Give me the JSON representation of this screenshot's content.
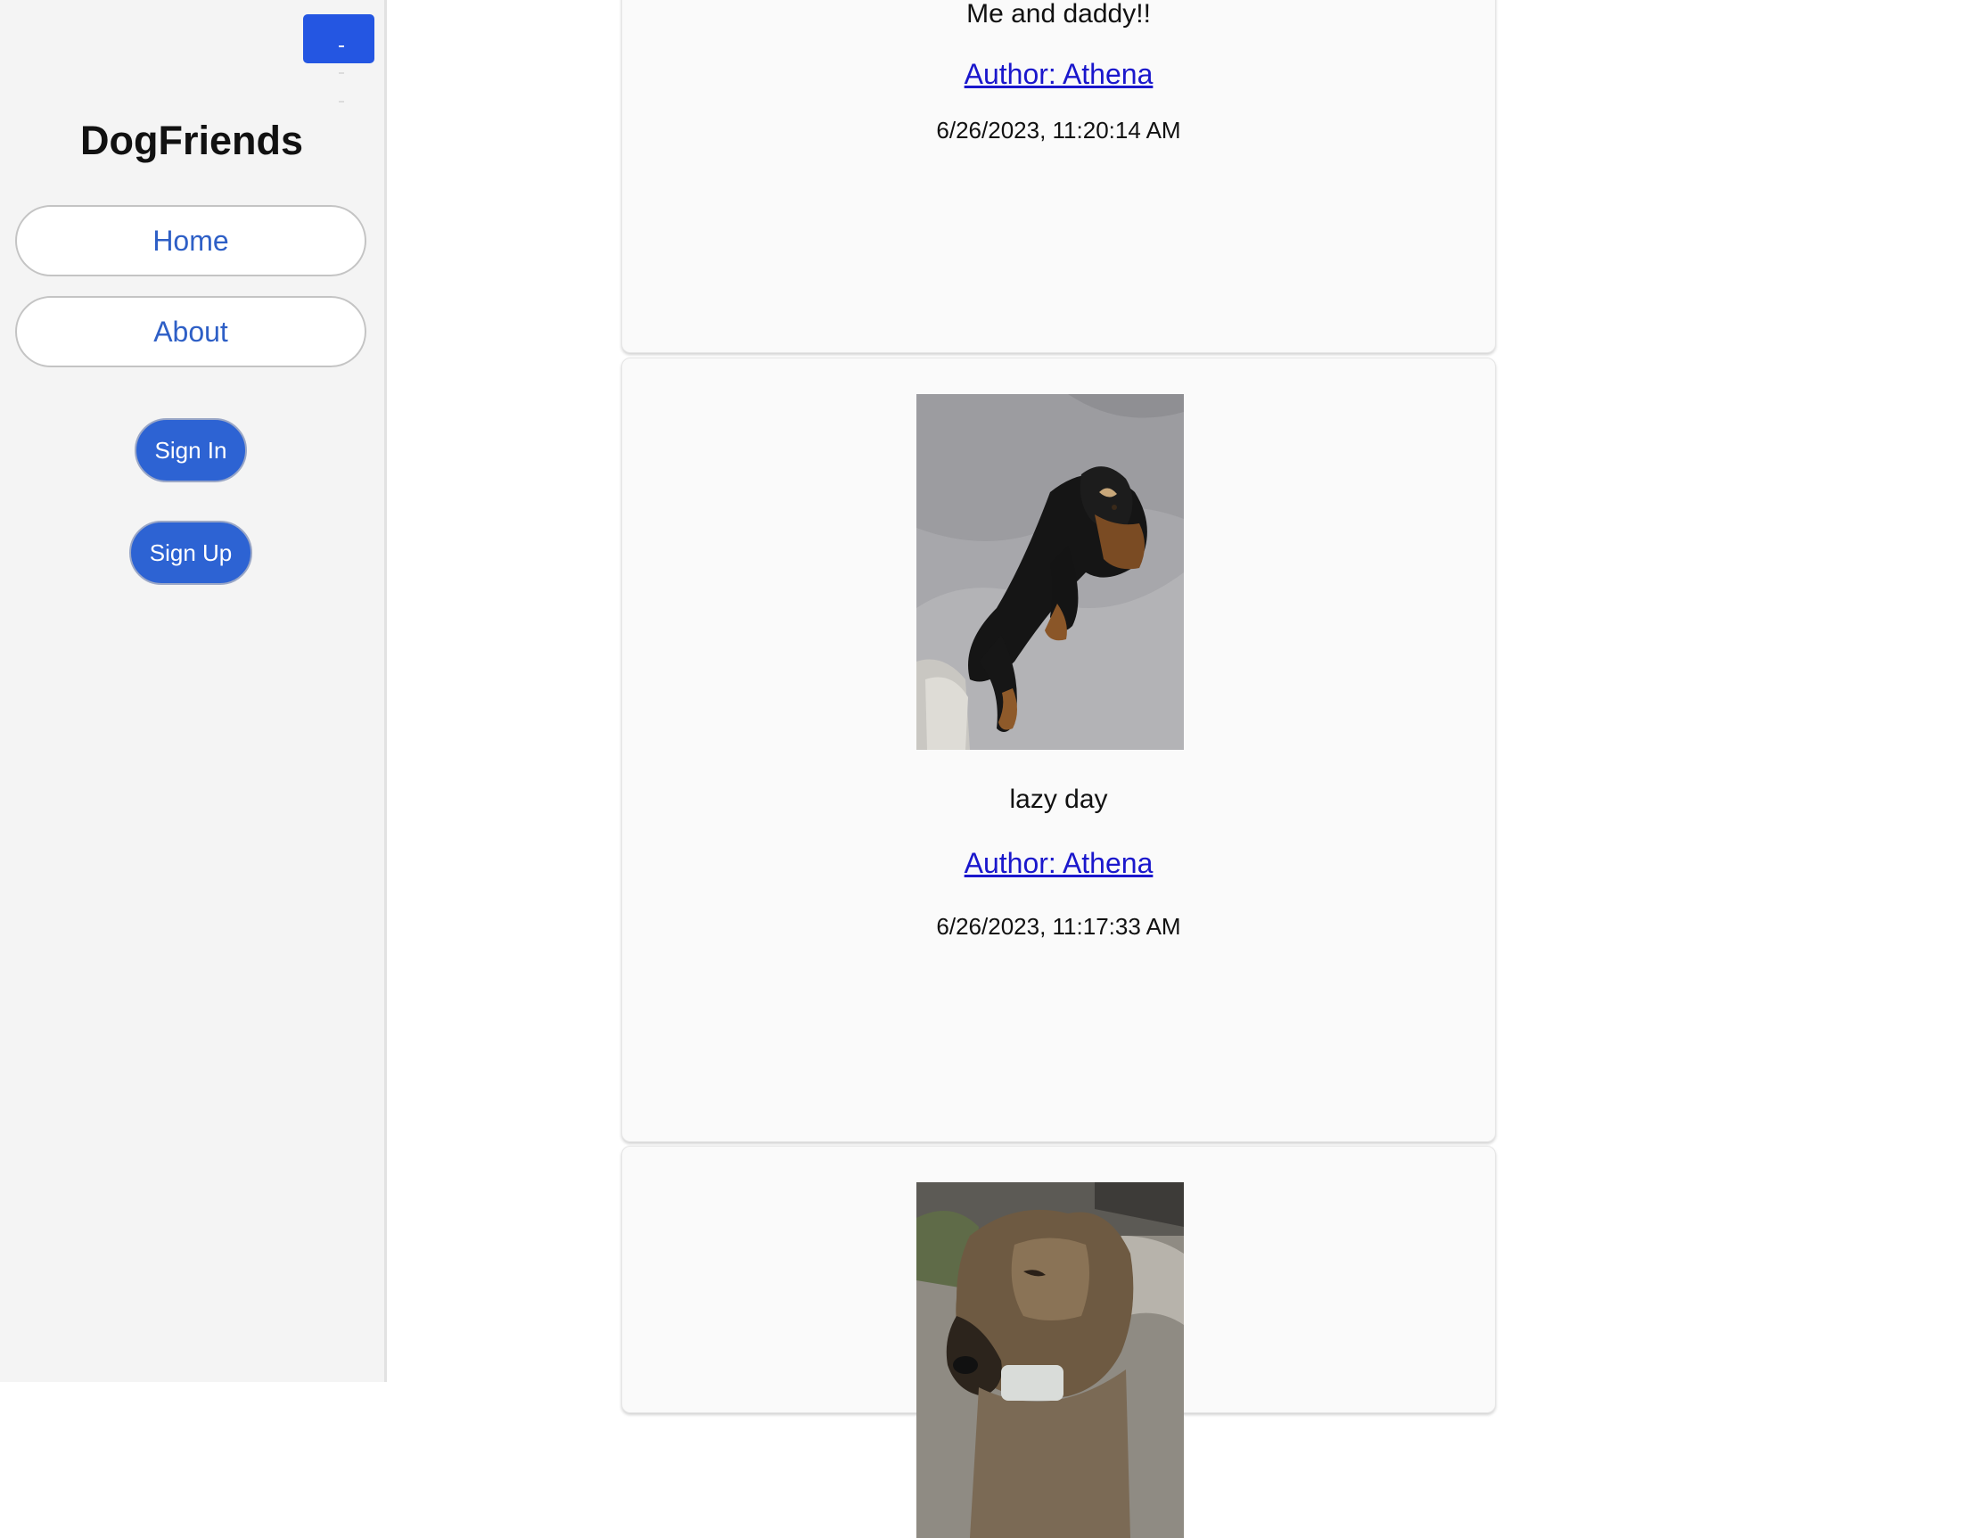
{
  "app": {
    "brand": "DogFriends",
    "accent_color": "#2456e2"
  },
  "sidebar": {
    "toggle_icon": "menu-icon",
    "nav": [
      {
        "label": "Home"
      },
      {
        "label": "About"
      }
    ],
    "auth": {
      "sign_in": "Sign In",
      "sign_up": "Sign Up"
    }
  },
  "feed": {
    "posts": [
      {
        "caption": "Me and daddy!!",
        "author": "Author: Athena",
        "timestamp": "6/26/2023, 11:20:14 AM"
      },
      {
        "image": "photo of a black and tan puppy lying on a gray couch",
        "caption": "lazy day",
        "author": "Author: Athena",
        "timestamp": "6/26/2023, 11:17:33 AM"
      },
      {
        "image": "photo of a brown dog close-up outdoors"
      }
    ]
  }
}
